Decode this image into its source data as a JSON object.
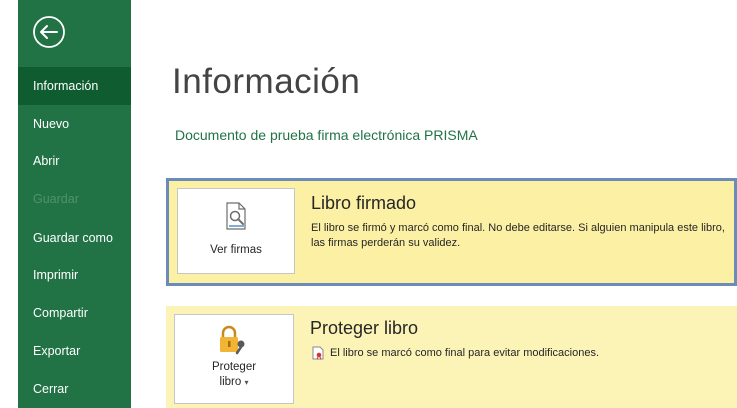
{
  "sidebar": {
    "back_icon": "back-arrow-circle-icon",
    "items": [
      {
        "label": "Información",
        "state": "active"
      },
      {
        "label": "Nuevo",
        "state": "normal"
      },
      {
        "label": "Abrir",
        "state": "normal"
      },
      {
        "label": "Guardar",
        "state": "disabled"
      },
      {
        "label": "Guardar como",
        "state": "normal"
      },
      {
        "label": "Imprimir",
        "state": "normal"
      },
      {
        "label": "Compartir",
        "state": "normal"
      },
      {
        "label": "Exportar",
        "state": "normal"
      },
      {
        "label": "Cerrar",
        "state": "normal"
      }
    ]
  },
  "main": {
    "title": "Información",
    "document_title": "Documento de  prueba firma electrónica PRISMA"
  },
  "signed_card": {
    "button_icon": "signature-document-icon",
    "button_label": "Ver firmas",
    "heading": "Libro firmado",
    "description": "El libro se firmó y marcó como final. No debe editarse. Si alguien manipula este libro, las firmas perderán su validez."
  },
  "protect_card": {
    "button_icon": "lock-key-icon",
    "button_label_line1": "Proteger",
    "button_label_line2": "libro",
    "heading": "Proteger libro",
    "status_icon": "marked-final-icon",
    "description": "El libro se marcó como final para evitar modificaciones."
  },
  "colors": {
    "sidebar": "#217346",
    "sidebar_active": "#0e5c2f",
    "card_background": "#fcf3b7",
    "card_border": "#6b8bbb",
    "accent_text": "#217346"
  }
}
